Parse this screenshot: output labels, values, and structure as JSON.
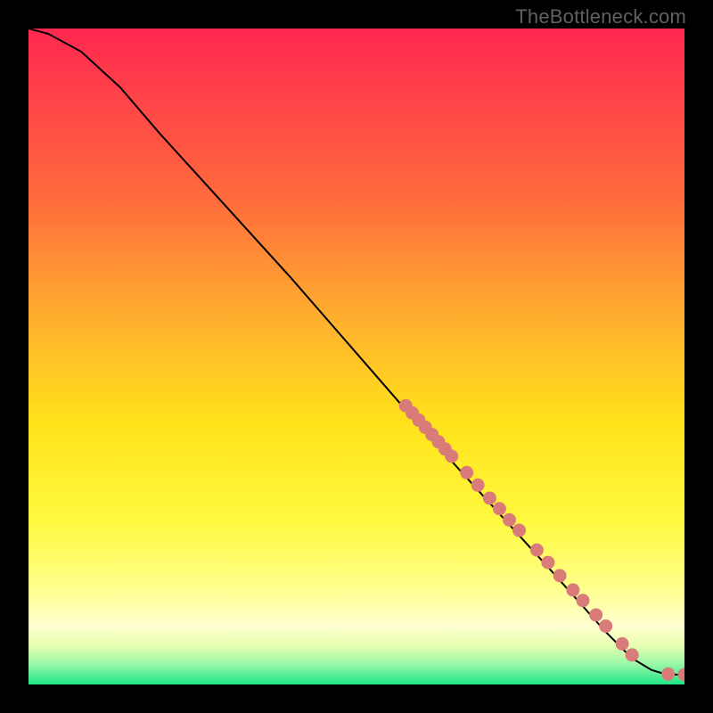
{
  "watermark": "TheBottleneck.com",
  "chart_data": {
    "type": "line",
    "title": "",
    "xlabel": "",
    "ylabel": "",
    "xlim": [
      0,
      100
    ],
    "ylim": [
      0,
      100
    ],
    "grid": false,
    "curve": [
      {
        "x": 0,
        "y": 100
      },
      {
        "x": 3,
        "y": 99.2
      },
      {
        "x": 8,
        "y": 96.5
      },
      {
        "x": 14,
        "y": 91
      },
      {
        "x": 20,
        "y": 84
      },
      {
        "x": 30,
        "y": 73
      },
      {
        "x": 40,
        "y": 62
      },
      {
        "x": 50,
        "y": 50.5
      },
      {
        "x": 60,
        "y": 39
      },
      {
        "x": 70,
        "y": 28
      },
      {
        "x": 80,
        "y": 17
      },
      {
        "x": 88,
        "y": 8
      },
      {
        "x": 92,
        "y": 4
      },
      {
        "x": 95,
        "y": 2.2
      },
      {
        "x": 97,
        "y": 1.6
      },
      {
        "x": 99,
        "y": 1.5
      },
      {
        "x": 100,
        "y": 1.5
      }
    ],
    "markers": [
      {
        "x": 57.5,
        "y": 42.5
      },
      {
        "x": 58.5,
        "y": 41.4
      },
      {
        "x": 59.5,
        "y": 40.3
      },
      {
        "x": 60.5,
        "y": 39.2
      },
      {
        "x": 61.5,
        "y": 38.1
      },
      {
        "x": 62.5,
        "y": 37.0
      },
      {
        "x": 63.5,
        "y": 35.9
      },
      {
        "x": 64.5,
        "y": 34.8
      },
      {
        "x": 66.8,
        "y": 32.3
      },
      {
        "x": 68.5,
        "y": 30.4
      },
      {
        "x": 70.3,
        "y": 28.4
      },
      {
        "x": 71.8,
        "y": 26.8
      },
      {
        "x": 73.3,
        "y": 25.1
      },
      {
        "x": 74.8,
        "y": 23.5
      },
      {
        "x": 77.5,
        "y": 20.5
      },
      {
        "x": 79.2,
        "y": 18.6
      },
      {
        "x": 81.0,
        "y": 16.6
      },
      {
        "x": 83.0,
        "y": 14.4
      },
      {
        "x": 84.5,
        "y": 12.8
      },
      {
        "x": 86.5,
        "y": 10.6
      },
      {
        "x": 88.0,
        "y": 8.9
      },
      {
        "x": 90.5,
        "y": 6.2
      },
      {
        "x": 92.0,
        "y": 4.5
      },
      {
        "x": 97.5,
        "y": 1.6
      },
      {
        "x": 100.0,
        "y": 1.5
      }
    ],
    "gradient_stops": [
      {
        "offset": 0.0,
        "color": "#ff2851"
      },
      {
        "offset": 0.25,
        "color": "#ff683d"
      },
      {
        "offset": 0.45,
        "color": "#ffb22e"
      },
      {
        "offset": 0.6,
        "color": "#ffe21a"
      },
      {
        "offset": 0.75,
        "color": "#fff93f"
      },
      {
        "offset": 0.85,
        "color": "#ffff8a"
      },
      {
        "offset": 0.91,
        "color": "#ffffd0"
      },
      {
        "offset": 0.94,
        "color": "#e7ffb0"
      },
      {
        "offset": 0.97,
        "color": "#96f7a8"
      },
      {
        "offset": 1.0,
        "color": "#1fe487"
      }
    ],
    "marker_color": "#d97b78",
    "curve_color": "#000000"
  }
}
